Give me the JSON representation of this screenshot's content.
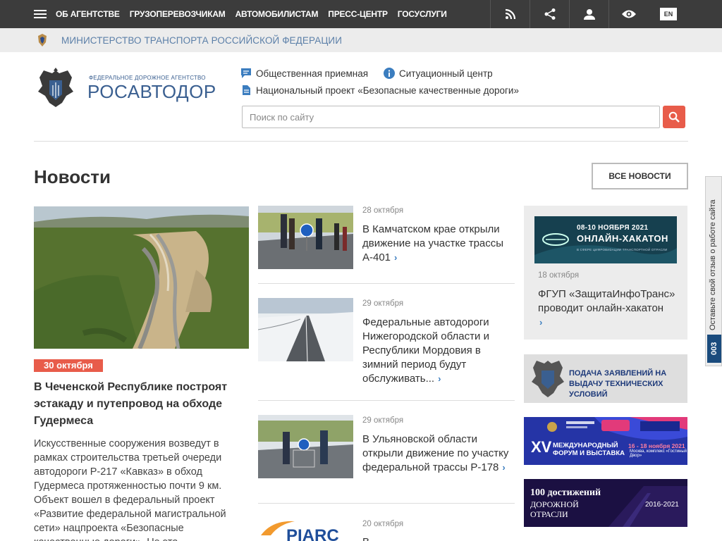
{
  "topbar": {
    "nav": [
      "ОБ АГЕНТСТВЕ",
      "ГРУЗОПЕРЕВОЗЧИКАМ",
      "АВТОМОБИЛИСТАМ",
      "ПРЕСС-ЦЕНТР",
      "ГОСУСЛУГИ"
    ],
    "lang": "EN",
    "icons": [
      "rss-icon",
      "share-icon",
      "user-icon",
      "eye-icon"
    ]
  },
  "ministry": {
    "name": "МИНИСТЕРСТВО ТРАНСПОРТА РОССИЙСКОЙ ФЕДЕРАЦИИ"
  },
  "logo": {
    "small": "Федеральное дорожное агентство",
    "big": "РОСАВТОДОР"
  },
  "header": {
    "link_reception": "Общественная приемная",
    "link_situation": "Ситуационный центр",
    "link_project": "Национальный проект «Безопасные качественные дороги»",
    "search_placeholder": "Поиск по сайту"
  },
  "news": {
    "title": "Новости",
    "all_label": "ВСЕ НОВОСТИ",
    "main": {
      "date": "30 октября",
      "title": "В Чеченской Республике построят эстакаду и путепровод на обходе Гудермеса",
      "text": "Искусственные сооружения возведут в рамках строительства третьей очереди автодороги Р-217 «Кавказ» в обход Гудермеса протяженностью почти 9 км. Объект вошел в федеральный проект «Развитие федеральной магистральной сети» нацпроекта «Безопасные качественные дороги». Не эта"
    },
    "items": [
      {
        "date": "28 октября",
        "title": "В Камчатском крае открыли движение на участке трассы А-401"
      },
      {
        "date": "29 октября",
        "title": "Федеральные автодороги Нижегородской области и Республики Мордовия в зимний период будут обслуживать..."
      },
      {
        "date": "29 октября",
        "title": "В Ульяновской области открыли движение по участку федеральной трассы Р-178"
      },
      {
        "date": "20 октября",
        "title": "В"
      }
    ],
    "side": {
      "banner_dates": "08-10 НОЯБРЯ 2021",
      "banner_title": "ОНЛАЙН-ХАКАТОН",
      "banner_sub": "В СФЕРЕ ЦИФРОВИЗАЦИИ ТРАНСПОРТНОЙ ОТРАСЛИ",
      "date": "18 октября",
      "title": "ФГУП «ЗащитаИнфоТранс» проводит онлайн-хакатон"
    }
  },
  "banners": {
    "tu": "ПОДАЧА ЗАЯВЛЕНИЙ НА ВЫДАЧУ ТЕХНИЧЕСКИХ УСЛОВИЙ",
    "forum_num": "XV",
    "forum_text": "МЕЖДУНАРОДНЫЙ ФОРУМ И ВЫСТАВКА",
    "forum_dates": "16 - 18 ноября 2021",
    "forum_place": "Москва, комплекс «Гостиный Двор»",
    "dost_num": "100 достижений",
    "dost_text": "ДОРОЖНОЙ ОТРАСЛИ",
    "dost_years": "2016-2021",
    "piarc": "PIARC"
  },
  "feedback": {
    "label": "Оставьте свой отзыв о работе сайта",
    "badge": "003"
  },
  "colors": {
    "accent": "#e85c4a",
    "brand": "#3a5f90",
    "link": "#3b7dbf"
  }
}
